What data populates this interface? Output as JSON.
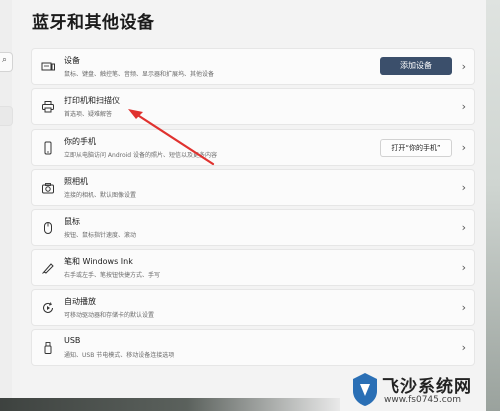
{
  "page": {
    "title": "蓝牙和其他设备"
  },
  "rows": [
    {
      "title": "设备",
      "desc": "鼠标、键盘、触控笔、音频、显示器和扩展坞、其他设备",
      "button": "添加设备"
    },
    {
      "title": "打印机和扫描仪",
      "desc": "首选项、疑难解答"
    },
    {
      "title": "你的手机",
      "desc": "立即从电脑访问 Android 设备的照片、短信以及更多内容",
      "button": "打开“你的手机”"
    },
    {
      "title": "照相机",
      "desc": "连接的相机、默认图像设置"
    },
    {
      "title": "鼠标",
      "desc": "按钮、鼠标指针速度、滚动"
    },
    {
      "title": "笔和 Windows Ink",
      "desc": "右手或左手、笔按钮快捷方式、手写"
    },
    {
      "title": "自动播放",
      "desc": "可移动驱动器和存储卡的默认设置"
    },
    {
      "title": "USB",
      "desc": "通知、USB 节电模式、移动设备连接选项"
    }
  ],
  "chevron": "›",
  "watermark": {
    "brand": "飞沙系统网",
    "url": "www.fs0745.com"
  },
  "colors": {
    "accent_button": "#3b4f6b",
    "arrow": "#e0322f"
  }
}
